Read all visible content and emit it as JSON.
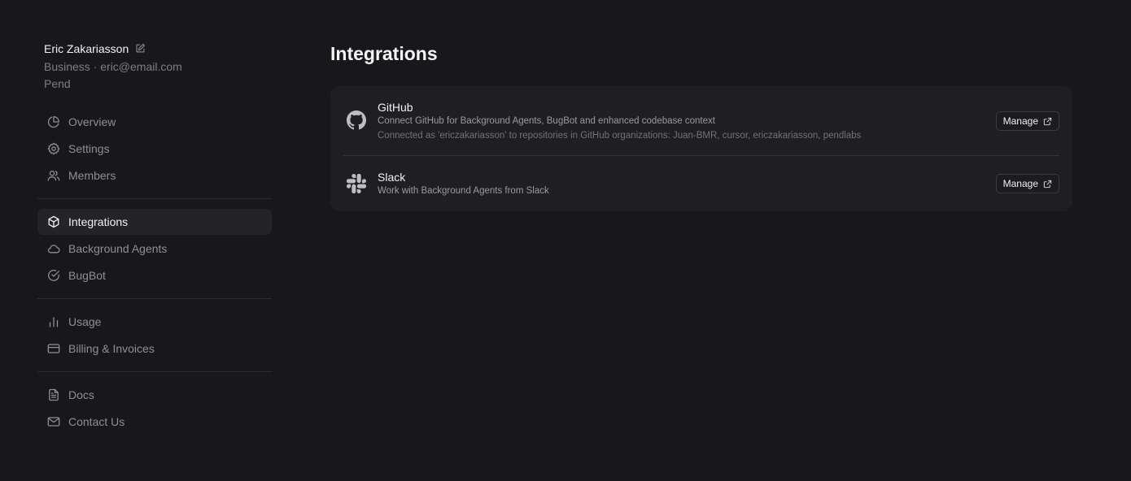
{
  "profile": {
    "name": "Eric Zakariasson",
    "plan_email": "Business · eric@email.com",
    "team": "Pend"
  },
  "sidebar": {
    "groups": [
      {
        "items": [
          {
            "label": "Overview",
            "icon": "pie-chart-icon"
          },
          {
            "label": "Settings",
            "icon": "gear-icon"
          },
          {
            "label": "Members",
            "icon": "users-icon"
          }
        ]
      },
      {
        "items": [
          {
            "label": "Integrations",
            "icon": "cube-icon",
            "active": true
          },
          {
            "label": "Background Agents",
            "icon": "cloud-icon"
          },
          {
            "label": "BugBot",
            "icon": "check-circle-icon"
          }
        ]
      },
      {
        "items": [
          {
            "label": "Usage",
            "icon": "bar-chart-icon"
          },
          {
            "label": "Billing & Invoices",
            "icon": "credit-card-icon"
          }
        ]
      },
      {
        "items": [
          {
            "label": "Docs",
            "icon": "document-icon"
          },
          {
            "label": "Contact Us",
            "icon": "mail-icon"
          }
        ]
      }
    ]
  },
  "main": {
    "title": "Integrations",
    "integrations": [
      {
        "name": "GitHub",
        "icon": "github-icon",
        "description": "Connect GitHub for Background Agents, BugBot and enhanced codebase context",
        "detail": "Connected as 'ericzakariasson' to repositories in GitHub organizations: Juan-BMR, cursor, ericzakariasson, pendlabs",
        "button_label": "Manage"
      },
      {
        "name": "Slack",
        "icon": "slack-icon",
        "description": "Work with Background Agents from Slack",
        "button_label": "Manage"
      }
    ]
  },
  "colors": {
    "background": "#18181c",
    "card": "#1f1f23",
    "active_nav": "#242428"
  }
}
